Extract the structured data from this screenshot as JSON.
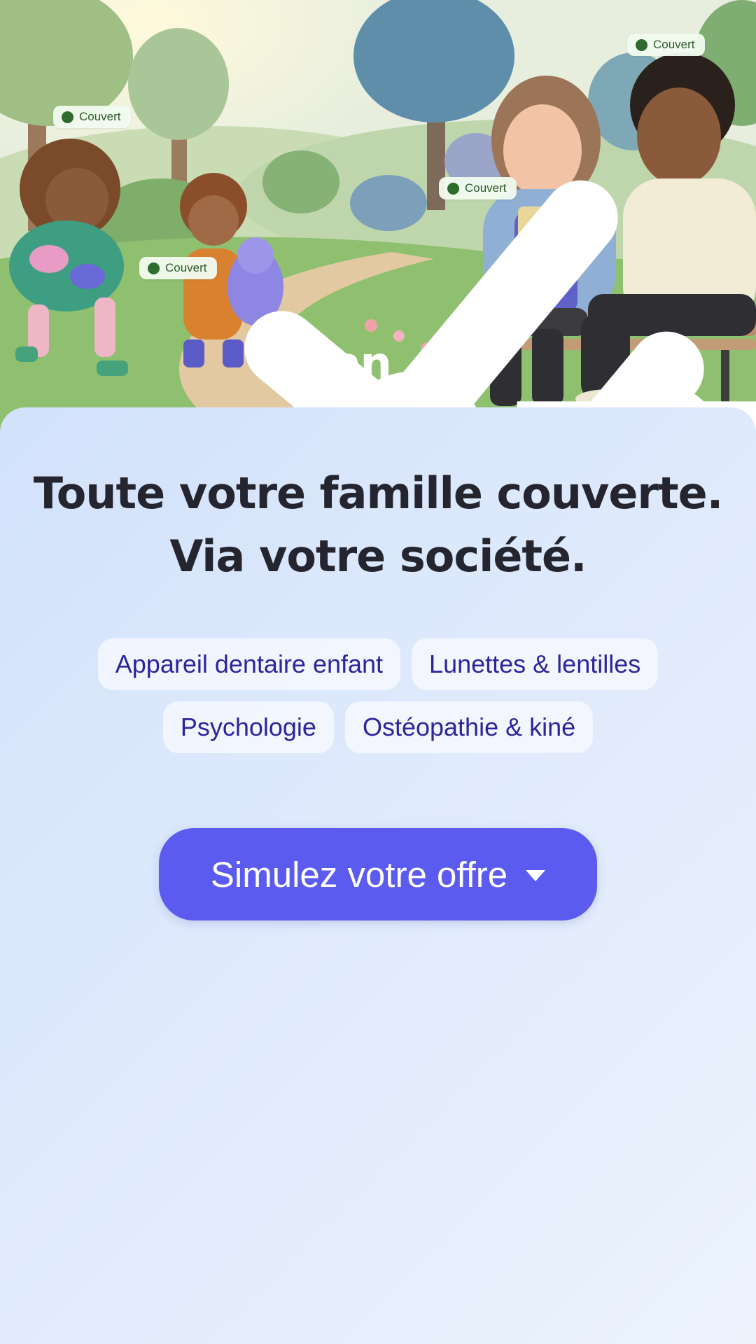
{
  "hero": {
    "badges": [
      "Couvert",
      "Couvert",
      "Couvert",
      "Couvert"
    ],
    "logo_text": "alan"
  },
  "main": {
    "headline_lines": [
      "Toute votre famille couverte.",
      "Via votre société."
    ],
    "chips": [
      "Appareil dentaire enfant",
      "Lunettes & lentilles",
      "Psychologie",
      "Ostéopathie & kiné"
    ],
    "cta_label": "Simulez votre offre",
    "cta_icon": "chevron-down-icon"
  },
  "colors": {
    "primary": "#5b5bef",
    "chip_text": "#2c249c",
    "headline": "#25252f",
    "badge_check": "#2f6b2c"
  }
}
